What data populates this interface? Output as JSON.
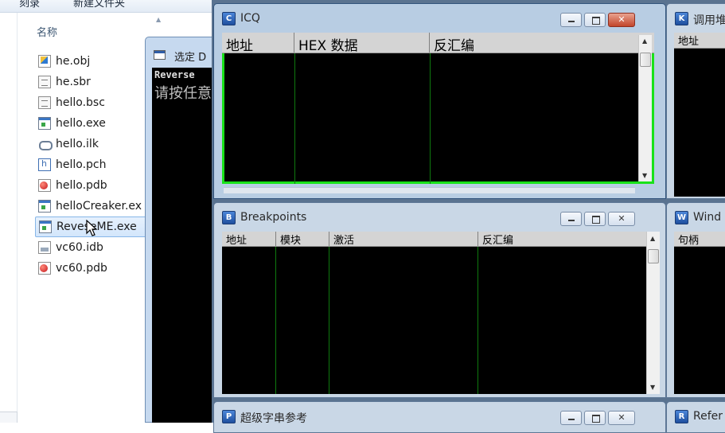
{
  "explorer": {
    "toolbar_left": "刻录",
    "toolbar_right": "新建文件夹",
    "column_name": "名称",
    "sort_arrow": "▲",
    "files": [
      {
        "name": "he.obj",
        "icon": "obj"
      },
      {
        "name": "he.sbr",
        "icon": "doc"
      },
      {
        "name": "hello.bsc",
        "icon": "doc"
      },
      {
        "name": "hello.exe",
        "icon": "exe"
      },
      {
        "name": "hello.ilk",
        "icon": "ilk"
      },
      {
        "name": "hello.pch",
        "icon": "pch"
      },
      {
        "name": "hello.pdb",
        "icon": "pdb"
      },
      {
        "name": "helloCreaker.ex",
        "icon": "exe"
      },
      {
        "name": "ReveseME.exe",
        "icon": "exe",
        "selected": true
      },
      {
        "name": "vc60.idb",
        "icon": "idb"
      },
      {
        "name": "vc60.pdb",
        "icon": "pdb"
      }
    ]
  },
  "console": {
    "title": "选定 D",
    "line1": "Reverse",
    "line2": "请按任意"
  },
  "icq_window": {
    "icon_letter": "C",
    "title": "ICQ",
    "columns": [
      "地址",
      "HEX 数据",
      "反汇编"
    ]
  },
  "k_window": {
    "icon_letter": "K",
    "title": "调用堆",
    "column": "地址"
  },
  "breakpoints_window": {
    "icon_letter": "B",
    "title": "Breakpoints",
    "columns": [
      "地址",
      "模块",
      "激活",
      "反汇编"
    ]
  },
  "w_window": {
    "icon_letter": "W",
    "title": "Wind",
    "column": "句柄"
  },
  "strings_window": {
    "icon_letter": "P",
    "title": "超级字串参考"
  },
  "r_window": {
    "icon_letter": "R",
    "title": "Refer"
  },
  "colors": {
    "mdi_background": "#5a7390",
    "active_border": "#19e219",
    "column_line": "#0f7a0f"
  }
}
